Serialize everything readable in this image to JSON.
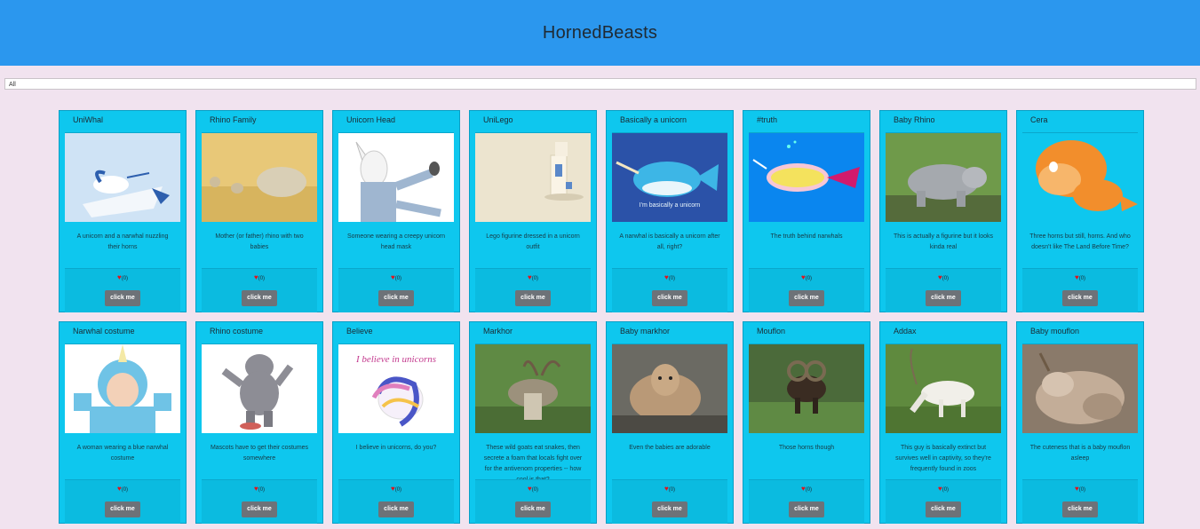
{
  "header": {
    "title": "HornedBeasts"
  },
  "filter": {
    "value": "All"
  },
  "like_prefix": "♥",
  "beasts": [
    {
      "title": "UniWhal",
      "description": "A unicorn and a narwhal nuzzling their horns",
      "likes": "(0)",
      "button": "click me"
    },
    {
      "title": "Rhino Family",
      "description": "Mother (or father) rhino with two babies",
      "likes": "(0)",
      "button": "click me"
    },
    {
      "title": "Unicorn Head",
      "description": "Someone wearing a creepy unicorn head mask",
      "likes": "(0)",
      "button": "click me"
    },
    {
      "title": "UniLego",
      "description": "Lego figurine dressed in a unicorn outfit",
      "likes": "(0)",
      "button": "click me"
    },
    {
      "title": "Basically a unicorn",
      "description": "A narwhal is basically a unicorn after all, right?",
      "likes": "(0)",
      "button": "click me"
    },
    {
      "title": "#truth",
      "description": "The truth behind narwhals",
      "likes": "(0)",
      "button": "click me"
    },
    {
      "title": "Baby Rhino",
      "description": "This is actually a figurine but it looks kinda real",
      "likes": "(0)",
      "button": "click me"
    },
    {
      "title": "Cera",
      "description": "Three horns but still, horns. And who doesn't like The Land Before Time?",
      "likes": "(0)",
      "button": "click me"
    },
    {
      "title": "Narwhal costume",
      "description": "A woman wearing a blue narwhal costume",
      "likes": "(0)",
      "button": "click me"
    },
    {
      "title": "Rhino costume",
      "description": "Mascots have to get their costumes somewhere",
      "likes": "(0)",
      "button": "click me"
    },
    {
      "title": "Believe",
      "description": "I believe in unicorns, do you?",
      "likes": "(0)",
      "button": "click me"
    },
    {
      "title": "Markhor",
      "description": "These wild goats eat snakes, then secrete a foam that locals fight over for the antivenom properties -- how cool is that?",
      "likes": "(0)",
      "button": "click me"
    },
    {
      "title": "Baby markhor",
      "description": "Even the babies are adorable",
      "likes": "(0)",
      "button": "click me"
    },
    {
      "title": "Mouflon",
      "description": "Those horns though",
      "likes": "(0)",
      "button": "click me"
    },
    {
      "title": "Addax",
      "description": "This guy is basically extinct but survives well in captivity, so they're frequently found in zoos",
      "likes": "(0)",
      "button": "click me"
    },
    {
      "title": "Baby mouflon",
      "description": "The cuteness that is a baby mouflon asleep",
      "likes": "(0)",
      "button": "click me"
    }
  ]
}
